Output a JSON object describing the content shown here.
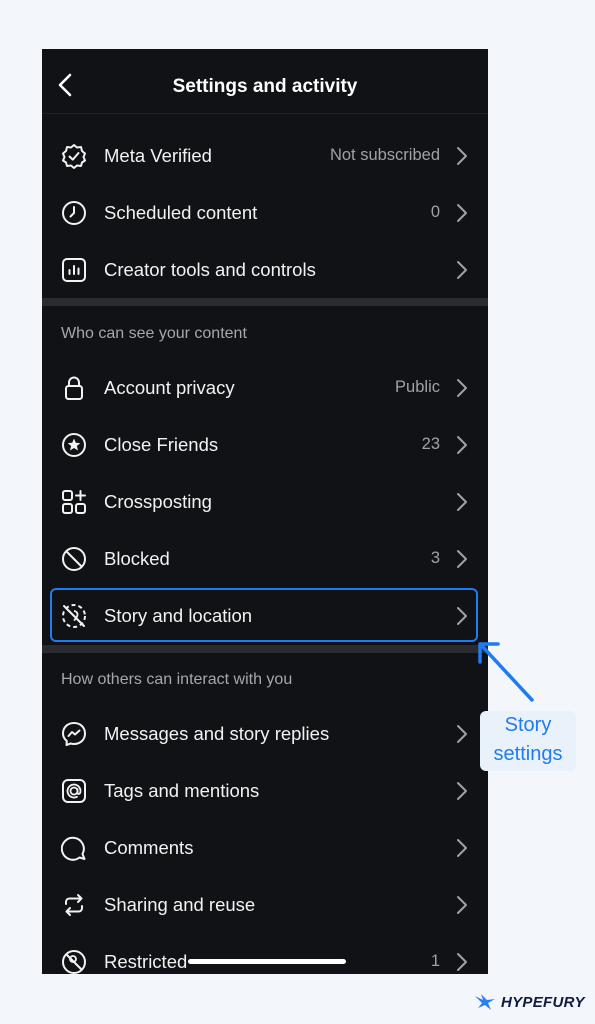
{
  "header": {
    "title": "Settings and activity",
    "back_icon": "chevron-left-icon"
  },
  "top_items": [
    {
      "label": "Meta Verified",
      "value": "Not subscribed",
      "icon": "verified-badge-icon"
    },
    {
      "label": "Scheduled content",
      "value": "0",
      "icon": "clock-icon"
    },
    {
      "label": "Creator tools and controls",
      "value": "",
      "icon": "chart-bars-icon"
    }
  ],
  "visibility_section": {
    "title": "Who can see your content",
    "items": [
      {
        "label": "Account privacy",
        "value": "Public",
        "icon": "lock-icon"
      },
      {
        "label": "Close Friends",
        "value": "23",
        "icon": "star-circle-icon"
      },
      {
        "label": "Crossposting",
        "value": "",
        "icon": "grid-plus-icon"
      },
      {
        "label": "Blocked",
        "value": "3",
        "icon": "block-icon"
      },
      {
        "label": "Story and location",
        "value": "",
        "icon": "story-location-icon",
        "highlighted": true
      }
    ]
  },
  "interaction_section": {
    "title": "How others can interact with you",
    "items": [
      {
        "label": "Messages and story replies",
        "value": "",
        "icon": "messenger-icon"
      },
      {
        "label": "Tags and mentions",
        "value": "",
        "icon": "at-sign-icon"
      },
      {
        "label": "Comments",
        "value": "",
        "icon": "comment-bubble-icon"
      },
      {
        "label": "Sharing and reuse",
        "value": "",
        "icon": "repost-icon"
      },
      {
        "label": "Restricted",
        "value": "1",
        "icon": "restricted-icon"
      }
    ]
  },
  "annotation": {
    "line1": "Story",
    "line2": "settings",
    "color": "#1e7cf0"
  },
  "branding": {
    "name": "HYPEFURY"
  }
}
